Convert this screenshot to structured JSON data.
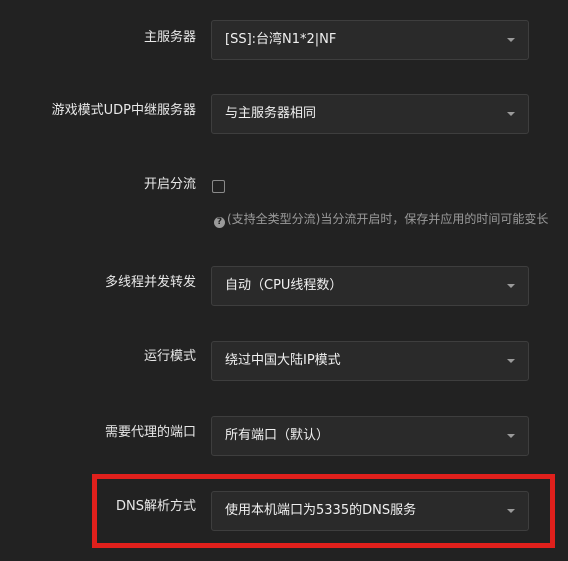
{
  "fields": {
    "main_server": {
      "label": "主服务器",
      "value": "[SS]:台湾N1*2|NF"
    },
    "udp_relay_server": {
      "label": "游戏模式UDP中继服务器",
      "value": "与主服务器相同"
    },
    "enable_split": {
      "label": "开启分流",
      "checked": false,
      "hint": "(支持全类型分流)当分流开启时，保存并应用的时间可能变长"
    },
    "multithread_forward": {
      "label": "多线程并发转发",
      "value": "自动（CPU线程数）"
    },
    "run_mode": {
      "label": "运行模式",
      "value": "绕过中国大陆IP模式"
    },
    "proxy_ports": {
      "label": "需要代理的端口",
      "value": "所有端口（默认）"
    },
    "dns_mode": {
      "label": "DNS解析方式",
      "value": "使用本机端口为5335的DNS服务"
    }
  },
  "colors": {
    "background": "#222222",
    "highlight_border": "#e0201c",
    "select_background": "#2a2a2a"
  },
  "icons": {
    "hint": "question-circle-icon",
    "dropdown": "caret-down-icon"
  }
}
